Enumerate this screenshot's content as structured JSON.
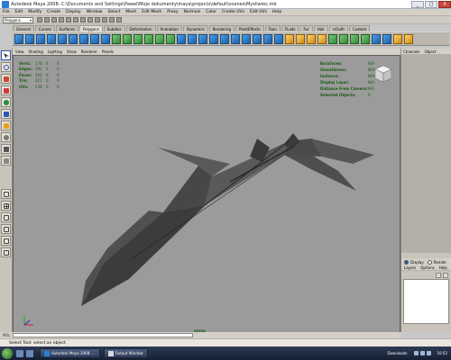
{
  "window": {
    "title": "Autodesk Maya 2008: C:\\Documents and Settings\\Pawel\\Moje dokumenty\\maya\\projects\\default\\scenes\\Myśliwiec.mb",
    "minimize": "_",
    "maximize": "□",
    "close": "X"
  },
  "menubar": [
    "File",
    "Edit",
    "Modify",
    "Create",
    "Display",
    "Window",
    "Select",
    "Mesh",
    "Edit Mesh",
    "Proxy",
    "Normals",
    "Color",
    "Create UVs",
    "Edit UVs",
    "Help"
  ],
  "statusline": {
    "mode": "Polygons"
  },
  "shelf_tabs": [
    "General",
    "Curves",
    "Surfaces",
    "Polygons",
    "Subdivs",
    "Deformation",
    "Animation",
    "Dynamics",
    "Rendering",
    "PaintEffects",
    "Toon",
    "Fluids",
    "Fur",
    "Hair",
    "nCloth",
    "Custom"
  ],
  "shelf_active": "Polygons",
  "panel_menu": [
    "View",
    "Shading",
    "Lighting",
    "Show",
    "Renderer",
    "Panels"
  ],
  "hud_left": [
    {
      "k": "Verts:",
      "a": "178",
      "b": "0",
      "c": "0"
    },
    {
      "k": "Edges:",
      "a": "282",
      "b": "0",
      "c": "0"
    },
    {
      "k": "Faces:",
      "a": "102",
      "b": "0",
      "c": "0"
    },
    {
      "k": "Tris:",
      "a": "212",
      "b": "0",
      "c": "0"
    },
    {
      "k": "UVs:",
      "a": "238",
      "b": "0",
      "c": "0"
    }
  ],
  "hud_right": [
    {
      "k": "Backfaces:",
      "v": "N/A"
    },
    {
      "k": "Smoothness:",
      "v": "N/A"
    },
    {
      "k": "Instance:",
      "v": "N/A"
    },
    {
      "k": "Display Layer:",
      "v": "N/A"
    },
    {
      "k": "Distance From Camera:",
      "v": "N/A"
    },
    {
      "k": "Selected Objects:",
      "v": "0"
    }
  ],
  "camera_label": "persp",
  "channel_box": {
    "tabs": [
      "Channels",
      "Object"
    ]
  },
  "layers": {
    "display": "Display",
    "render": "Render",
    "menu": [
      "Layers",
      "Options",
      "Help"
    ]
  },
  "cmdline": {
    "label": "MEL"
  },
  "helpline": "Select Tool: select an object",
  "taskbar": {
    "tasks": [
      "Autodesk Maya 2008: ...",
      "Output Window"
    ],
    "downloads": "Downloads",
    "clock": "10:52"
  },
  "colors": {
    "viewport_bg": "#9b9b9b",
    "hud_text": "#1a5a14",
    "model": "#4a4a4a"
  }
}
